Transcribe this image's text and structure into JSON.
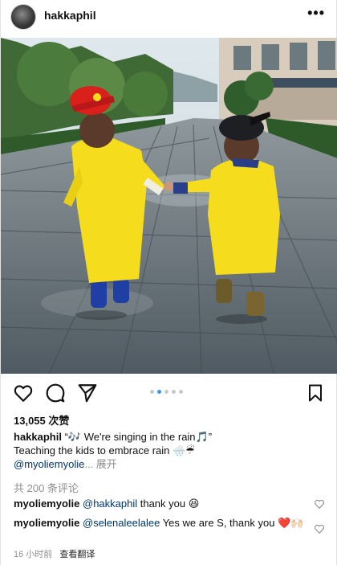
{
  "post": {
    "username": "hakkaphil",
    "more_label": "•••",
    "likes": "13,055 次赞",
    "caption_line1": "“🎶 We're singing in the rain🎵”",
    "caption_line2": "Teaching the kids to embrace rain 🌧️☔",
    "caption_mention": "@myoliemyolie",
    "caption_more": "... 展开",
    "comments_link": "共 200 条评论",
    "timestamp": "16 小时前",
    "translate": "查看翻译"
  },
  "comments": [
    {
      "user": "myoliemyolie",
      "mention": "@hakkaphil",
      "text": " thank you 😆"
    },
    {
      "user": "myoliemyolie",
      "mention": "@selenaleelalee",
      "text": " Yes we are S, thank you ❤️🙌🏻"
    }
  ],
  "carousel": {
    "count": 5,
    "active": 1
  },
  "colors": {
    "accent": "#3897f0",
    "raincoat": "#f5dd1d",
    "mention": "#00376b"
  }
}
